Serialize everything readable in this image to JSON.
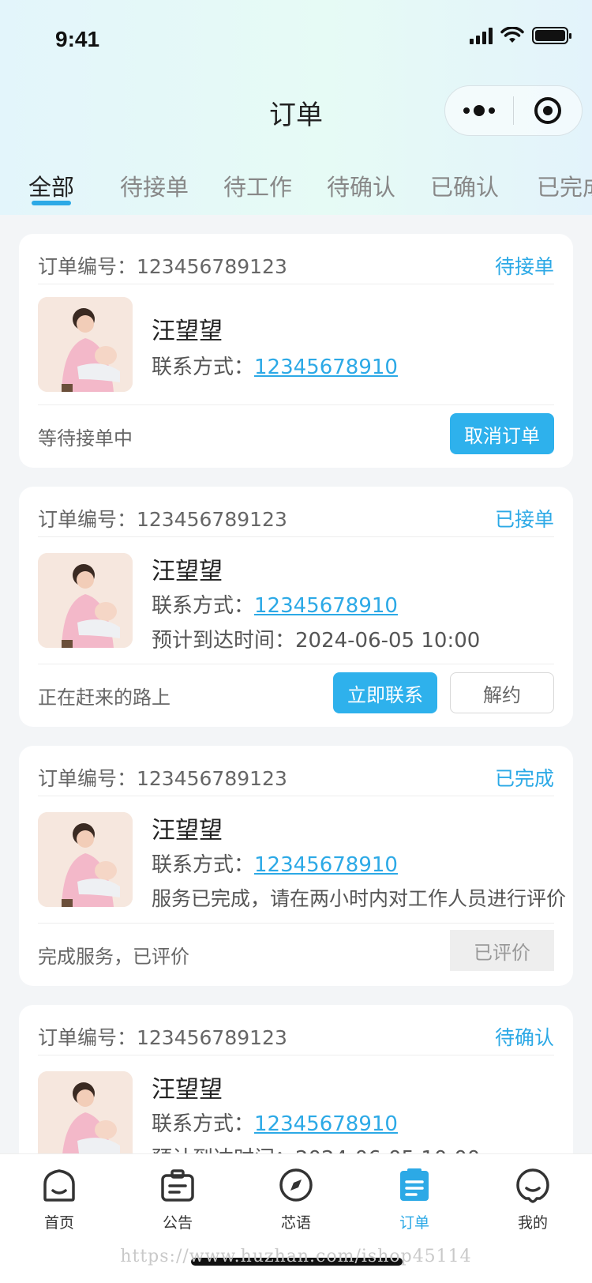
{
  "status_bar": {
    "time": "9:41"
  },
  "navbar": {
    "title": "订单"
  },
  "tabs": [
    {
      "label": "全部",
      "active": true
    },
    {
      "label": "待接单",
      "active": false
    },
    {
      "label": "待工作",
      "active": false
    },
    {
      "label": "待确认",
      "active": false
    },
    {
      "label": "已确认",
      "active": false
    },
    {
      "label": "已完成",
      "active": false
    }
  ],
  "orders": [
    {
      "order_no": "订单编号：123456789123",
      "status": "待接单",
      "name": "汪望望",
      "contact_label": "联系方式：",
      "phone": "12345678910",
      "extra": "",
      "foot_text": "等待接单中",
      "buttons": [
        "取消订单"
      ]
    },
    {
      "order_no": "订单编号：123456789123",
      "status": "已接单",
      "name": "汪望望",
      "contact_label": "联系方式：",
      "phone": "12345678910",
      "extra": "预计到达时间：2024-06-05 10:00",
      "foot_text": "正在赶来的路上",
      "buttons": [
        "立即联系",
        "解约"
      ]
    },
    {
      "order_no": "订单编号：123456789123",
      "status": "已完成",
      "name": "汪望望",
      "contact_label": "联系方式：",
      "phone": "12345678910",
      "extra": "服务已完成，请在两小时内对工作人员进行评价",
      "foot_text": "完成服务，已评价",
      "buttons": [
        "已评价"
      ]
    },
    {
      "order_no": "订单编号：123456789123",
      "status": "待确认",
      "name": "汪望望",
      "contact_label": "联系方式：",
      "phone": "12345678910",
      "extra": "预计到达时间：2024-06-05 10:00"
    }
  ],
  "tabbar": [
    {
      "label": "首页",
      "icon": "home-icon"
    },
    {
      "label": "公告",
      "icon": "notice-icon"
    },
    {
      "label": "芯语",
      "icon": "compass-icon"
    },
    {
      "label": "订单",
      "icon": "order-icon",
      "active": true
    },
    {
      "label": "我的",
      "icon": "profile-icon"
    }
  ],
  "watermark": "https://www.huzhan.com/ishop45114",
  "colors": {
    "accent": "#2ca9e6",
    "button": "#2eb1ec"
  }
}
